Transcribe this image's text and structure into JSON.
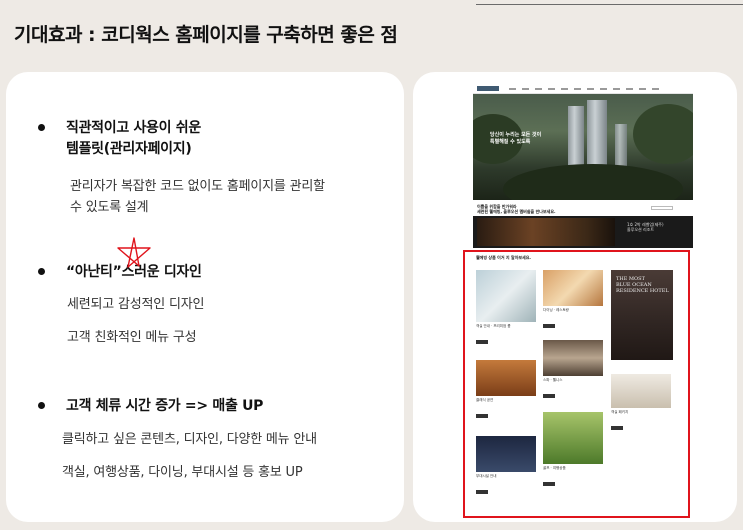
{
  "title": "기대효과 : 코디웍스 홈페이지를 구축하면 좋은 점",
  "bullets": [
    {
      "heading": "직관적이고 사용이 쉬운\n템플릿(관리자페이지)",
      "desc": [
        "관리자가 복잡한 코드 없이도 홈페이지를 관리할\n수 있도록 설계"
      ]
    },
    {
      "heading": "“아난티”스러운 디자인",
      "desc": [
        "세련되고 감성적인 디자인",
        "고객 친화적인 메뉴 구성"
      ]
    },
    {
      "heading": "고객 체류 시간 증가 => 매출 UP",
      "desc": [
        "클릭하고 싶은 콘텐츠, 디자인, 다양한 메뉴 안내",
        "객실, 여행상품, 다이닝, 부대시설 등 홍보 UP"
      ]
    }
  ],
  "preview": {
    "hero_text": "당신이 누리는 모든 것이\n특별해질 수 있도록",
    "section_text": "이쁨을 위함을 반가워라\n세련된 웰에빙, 올루오션 멤버쉽을 만나보세요.",
    "banner_text": "1호 2박 레벨업(제주)\n올루오션 리조트",
    "grid_title": "웰에빙 상품 이거 지 알아보세요.",
    "ad_text": "THE MOST\nBLUE OCEAN\nRESIDENCE HOTEL"
  },
  "colors": {
    "background": "#eeeae5",
    "card": "#ffffff",
    "highlight": "#e0141c",
    "star": "#e0141c"
  }
}
